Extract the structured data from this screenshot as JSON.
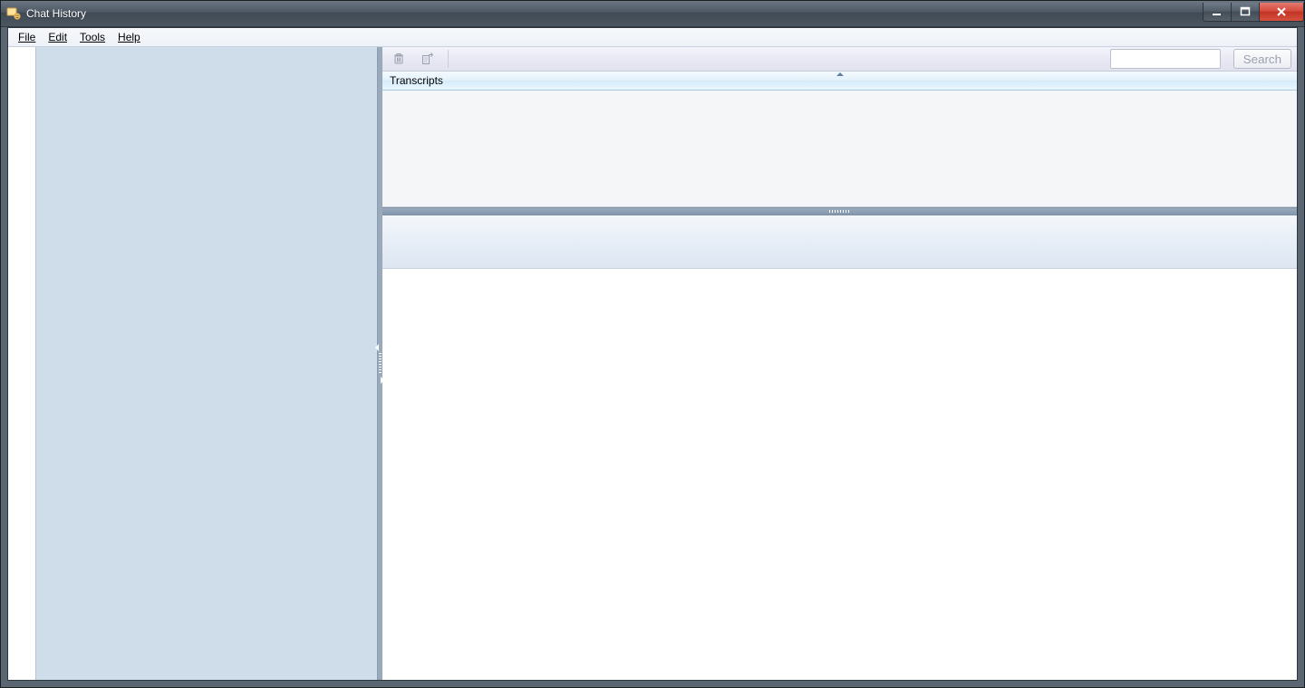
{
  "window": {
    "title": "Chat History"
  },
  "menu": {
    "file": "File",
    "edit": "Edit",
    "tools": "Tools",
    "help": "Help"
  },
  "toolbar": {
    "search_button": "Search",
    "search_value": ""
  },
  "columns": {
    "transcripts": "Transcripts"
  }
}
